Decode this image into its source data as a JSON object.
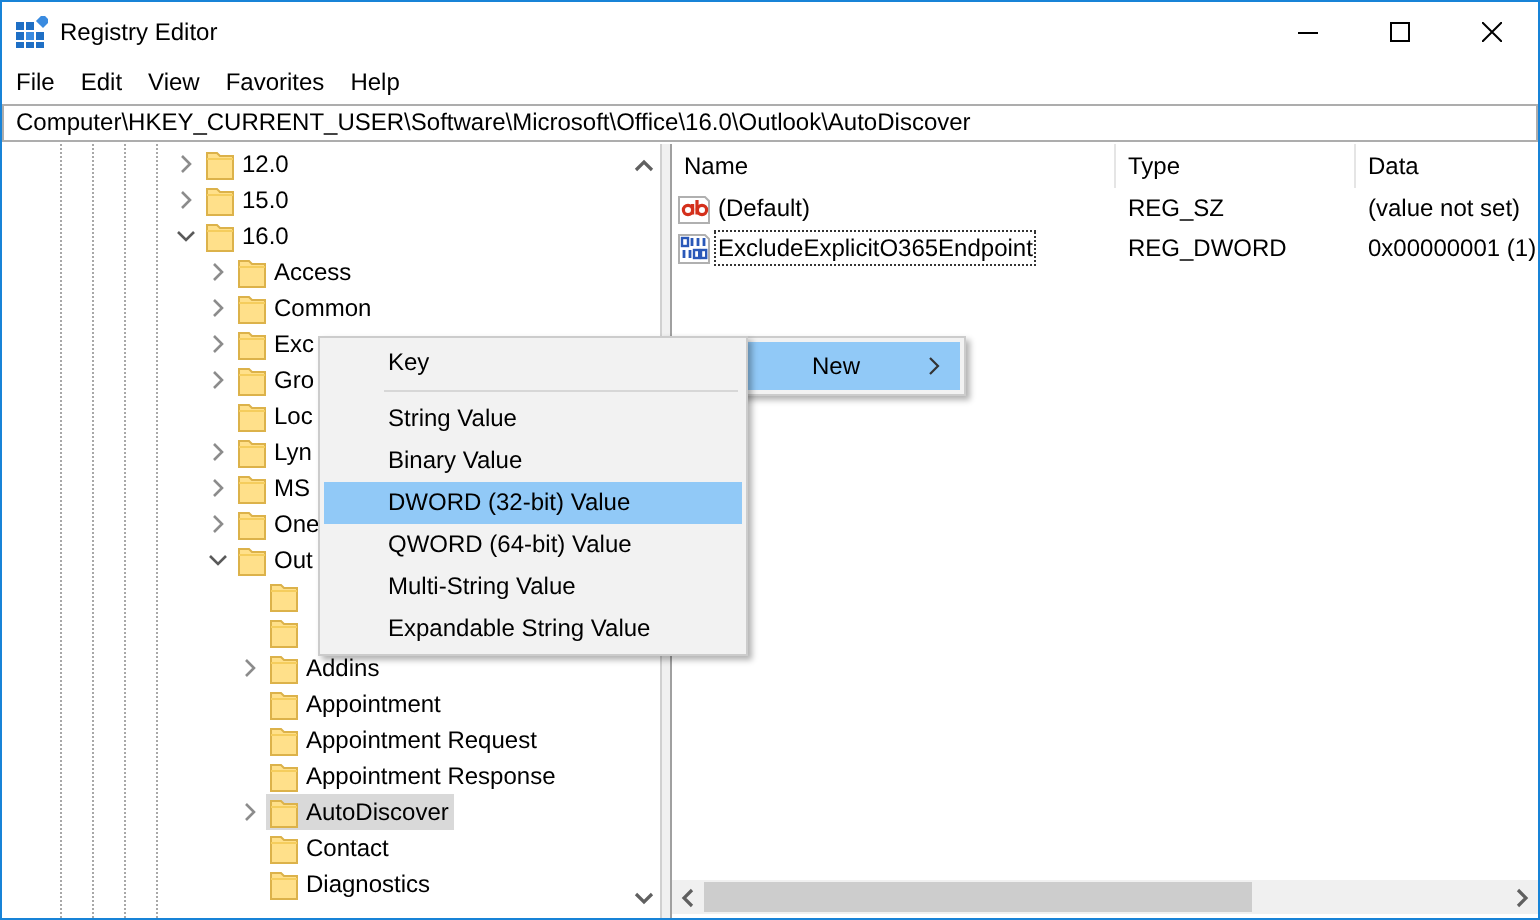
{
  "window": {
    "title": "Registry Editor"
  },
  "menu_bar": [
    "File",
    "Edit",
    "View",
    "Favorites",
    "Help"
  ],
  "address_bar": {
    "value": "Computer\\HKEY_CURRENT_USER\\Software\\Microsoft\\Office\\16.0\\Outlook\\AutoDiscover"
  },
  "tree": [
    {
      "label": "12.0",
      "kind": "branch",
      "expanded": false,
      "selected": false
    },
    {
      "label": "15.0",
      "kind": "branch",
      "expanded": false,
      "selected": false
    },
    {
      "label": "16.0",
      "kind": "branch",
      "expanded": true,
      "selected": false,
      "children": [
        {
          "label": "Access",
          "kind": "branch",
          "expanded": false,
          "selected": false
        },
        {
          "label": "Common",
          "kind": "branch",
          "expanded": false,
          "selected": false
        },
        {
          "label": "Exc",
          "kind": "branch",
          "expanded": false,
          "selected": false
        },
        {
          "label": "Gro",
          "kind": "branch",
          "expanded": false,
          "selected": false
        },
        {
          "label": "Loc",
          "kind": "leaf",
          "selected": false
        },
        {
          "label": "Lyn",
          "kind": "branch",
          "expanded": false,
          "selected": false
        },
        {
          "label": "MS",
          "kind": "branch",
          "expanded": false,
          "selected": false
        },
        {
          "label": "One",
          "kind": "branch",
          "expanded": false,
          "selected": false
        },
        {
          "label": "Out",
          "kind": "branch",
          "expanded": true,
          "selected": false,
          "children": [
            {
              "kind": "leaf",
              "selected": false
            },
            {
              "kind": "leaf",
              "selected": false
            },
            {
              "label": "Addins",
              "kind": "branch",
              "expanded": false,
              "selected": false
            },
            {
              "label": "Appointment",
              "kind": "leaf",
              "selected": false
            },
            {
              "label": "Appointment Request",
              "kind": "leaf",
              "selected": false
            },
            {
              "label": "Appointment Response",
              "kind": "leaf",
              "selected": false
            },
            {
              "label": "AutoDiscover",
              "kind": "branch",
              "expanded": false,
              "selected": true
            },
            {
              "label": "Contact",
              "kind": "leaf",
              "selected": false
            },
            {
              "label": "Diagnostics",
              "kind": "leaf",
              "selected": false
            }
          ]
        }
      ]
    }
  ],
  "values_table": {
    "columns": [
      "Name",
      "Type",
      "Data"
    ],
    "rows": [
      {
        "kind": "string",
        "name": "(Default)",
        "type": "REG_SZ",
        "data": "(value not set)",
        "focused": false
      },
      {
        "kind": "binary",
        "name": "ExcludeExplicitO365Endpoint",
        "type": "REG_DWORD",
        "data": "0x00000001 (1)",
        "focused": true
      }
    ]
  },
  "context_menu": {
    "items": [
      {
        "label": "New",
        "selected": true,
        "has_submenu": true
      }
    ]
  },
  "new_submenu": {
    "items": [
      {
        "kind": "item",
        "label": "Key",
        "selected": false
      },
      {
        "kind": "separator"
      },
      {
        "kind": "item",
        "label": "String Value",
        "selected": false
      },
      {
        "kind": "item",
        "label": "Binary Value",
        "selected": false
      },
      {
        "kind": "item",
        "label": "DWORD (32-bit) Value",
        "selected": true
      },
      {
        "kind": "item",
        "label": "QWORD (64-bit) Value",
        "selected": false
      },
      {
        "kind": "item",
        "label": "Multi-String Value",
        "selected": false
      },
      {
        "kind": "item",
        "label": "Expandable String Value",
        "selected": false
      }
    ]
  }
}
